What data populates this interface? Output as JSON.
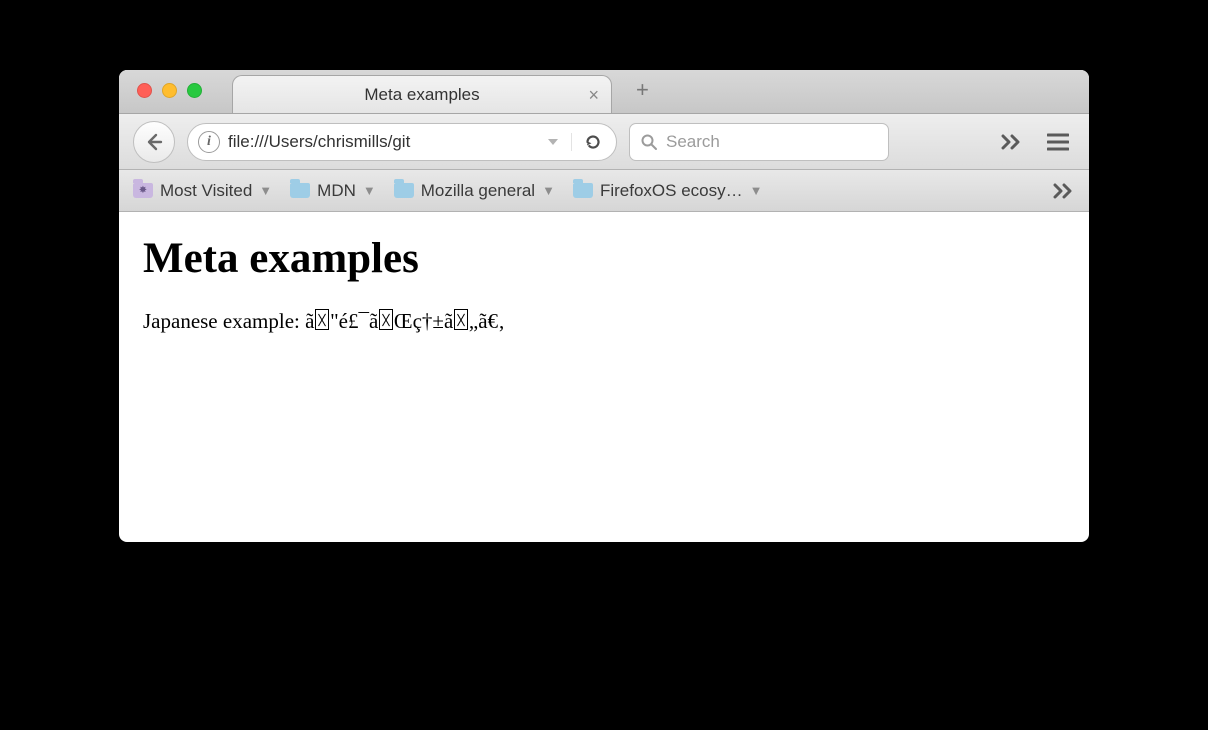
{
  "tab": {
    "title": "Meta examples"
  },
  "urlbar": {
    "value": "file:///Users/chrismills/git"
  },
  "search": {
    "placeholder": "Search"
  },
  "bookmarks": {
    "items": [
      {
        "label": "Most Visited"
      },
      {
        "label": "MDN"
      },
      {
        "label": "Mozilla general"
      },
      {
        "label": "FirefoxOS ecosy…"
      }
    ]
  },
  "page": {
    "heading": "Meta examples",
    "body_prefix": "Japanese example: ",
    "garbled": [
      "ã",
      "TOFU",
      "\"é£¯ã",
      "TOFU",
      "Œç†±ã",
      "TOFU",
      "„ã€‚"
    ]
  }
}
